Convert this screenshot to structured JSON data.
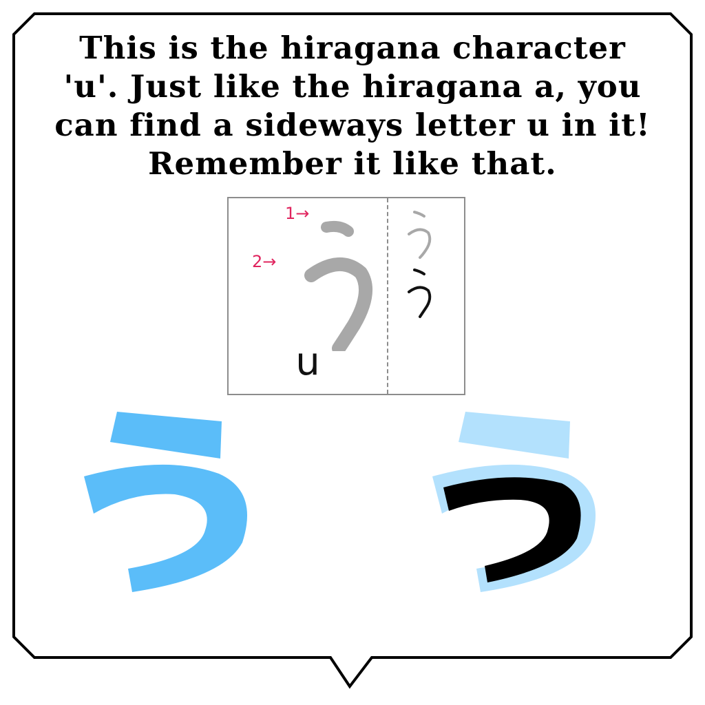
{
  "caption": {
    "line1": "This is the hiragana character",
    "line2": "'u'. Just like the hiragana a, you",
    "line3": "can find a sideways letter u in it!",
    "line4": "Remember it like that."
  },
  "stroke_card": {
    "romaji": "u",
    "stroke_order_1": "1→",
    "stroke_order_2": "2→"
  },
  "colors": {
    "bubble_outline": "#000000",
    "stroke_order_label": "#e0245e",
    "guide_glyph_gray": "#a8a8a8",
    "blue_glyph": "#5bbdf9",
    "light_blue_glyph": "#b3e1fd",
    "brush_glyph": "#000000"
  },
  "icons": {
    "main_glyph": "hiragana-u-stroke-order-glyph",
    "mini_glyph_gray": "hiragana-u-faded-practice-glyph",
    "mini_glyph_black": "hiragana-u-practice-glyph",
    "blue_glyph": "hiragana-u-blue-glyph",
    "brush_glyph": "hiragana-u-brush-trace-glyph"
  }
}
